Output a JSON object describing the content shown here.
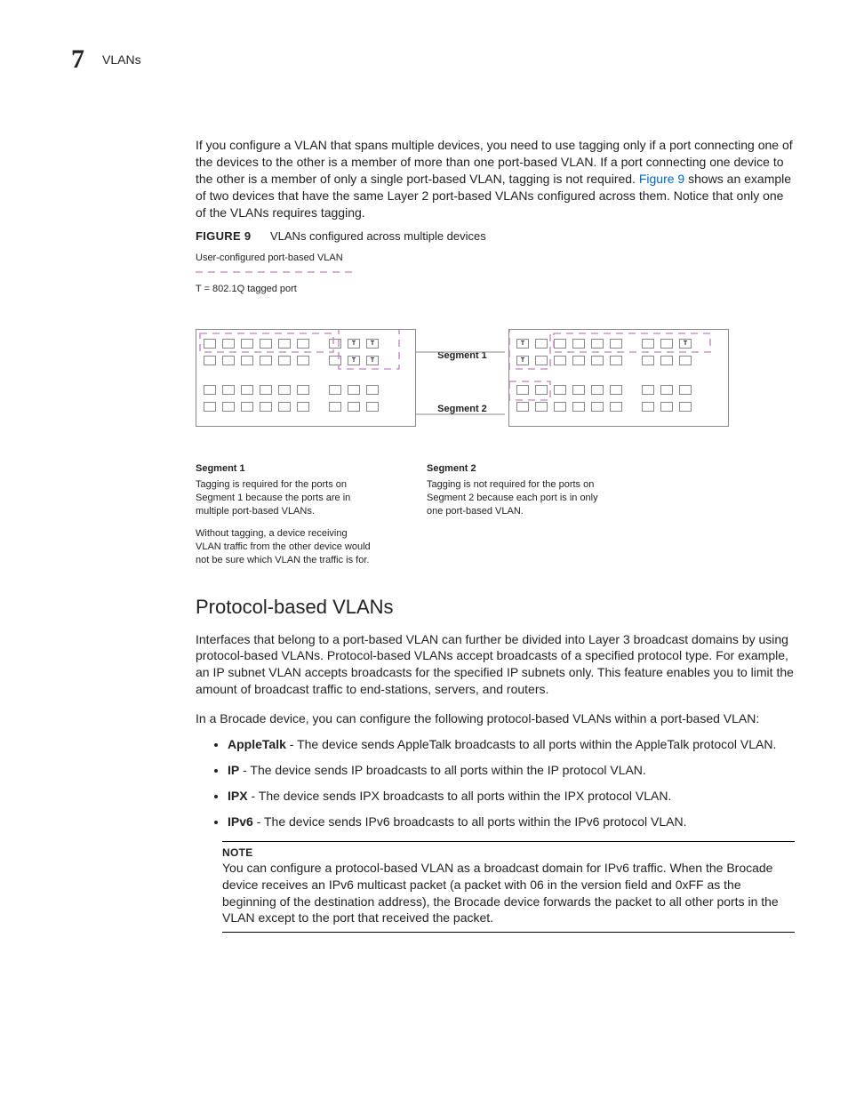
{
  "header": {
    "chapter_number": "7",
    "title": "VLANs"
  },
  "intro": {
    "para1_pre": "If you configure a VLAN that spans multiple devices, you need to use tagging only if a port connecting one of the devices to the other is a member of more than one port-based VLAN. If a port connecting one device to the other is a member of only a single port-based VLAN, tagging is not required. ",
    "figref": "Figure 9",
    "para1_post": " shows an example of two devices that have the same Layer 2 port-based VLANs configured across them. Notice that only one of the VLANs requires tagging."
  },
  "figure": {
    "label": "FIGURE 9",
    "caption": "VLANs configured across multiple devices",
    "legend1": "User-configured port-based VLAN",
    "legend2": "T = 802.1Q tagged port",
    "segment1": "Segment 1",
    "segment2": "Segment 2",
    "t": "T",
    "explain": {
      "seg1_title": "Segment 1",
      "seg1_p1": "Tagging is required for the ports on Segment 1 because the ports are in multiple port-based VLANs.",
      "seg1_p2": "Without tagging, a device receiving VLAN traffic from the other device would not be sure which VLAN the traffic is for.",
      "seg2_title": "Segment 2",
      "seg2_p1": "Tagging is not required for the ports on Segment 2 because each port is in only one port-based VLAN."
    }
  },
  "section": {
    "heading": "Protocol-based VLANs",
    "para1": "Interfaces that belong to a port-based VLAN can further be divided into Layer 3 broadcast domains by using protocol-based VLANs. Protocol-based VLANs accept broadcasts of a specified protocol type. For example, an IP subnet VLAN accepts broadcasts for the specified IP subnets only. This feature enables you to limit the amount of broadcast traffic to end-stations, servers, and routers.",
    "para2": "In a Brocade device, you can configure the following protocol-based VLANs within a port-based VLAN:",
    "bullets": [
      {
        "b": "AppleTalk",
        "t": " - The device sends AppleTalk broadcasts to all ports within the AppleTalk protocol VLAN."
      },
      {
        "b": "IP",
        "t": " - The device sends IP broadcasts to all ports within the IP protocol VLAN."
      },
      {
        "b": "IPX",
        "t": " - The device sends IPX broadcasts to all ports within the IPX protocol VLAN."
      },
      {
        "b": "IPv6",
        "t": " - The device sends IPv6 broadcasts to all ports within the IPv6 protocol VLAN."
      }
    ],
    "note_label": "NOTE",
    "note_text": "You can configure a protocol-based VLAN as a broadcast domain for IPv6 traffic. When the Brocade device receives an IPv6 multicast packet (a packet with 06 in the version field and 0xFF as the beginning of the destination address), the Brocade device forwards the packet to all other ports in the VLAN except to the port that received the packet."
  }
}
